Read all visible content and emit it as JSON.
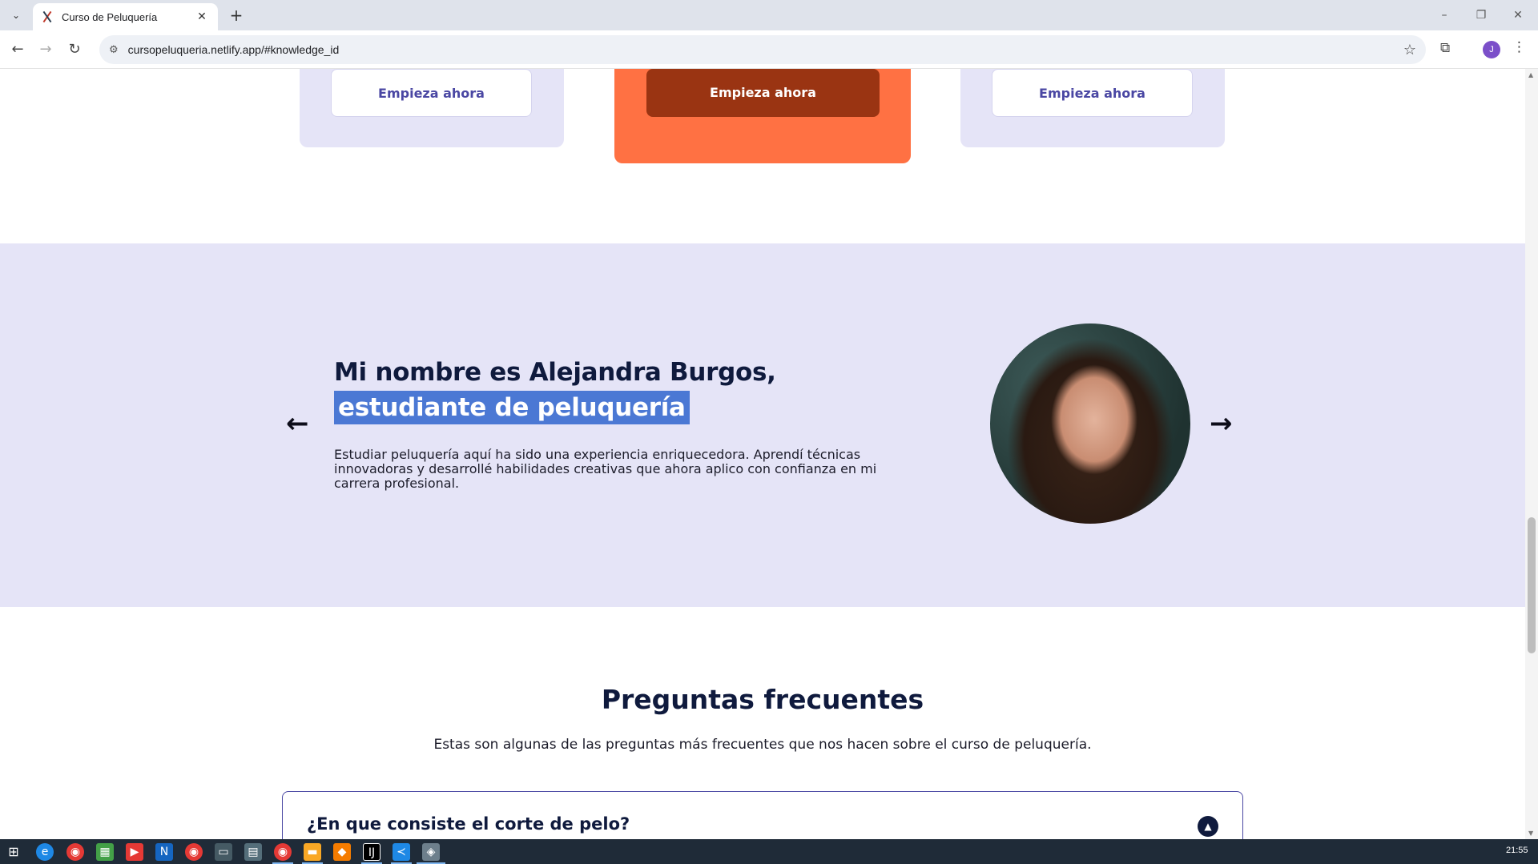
{
  "browser": {
    "tab_title": "Curso de Peluquería",
    "url": "cursopeluqueria.netlify.app/#knowledge_id",
    "profile_initial": "J"
  },
  "pricing": {
    "cta_labels": [
      "Empieza ahora",
      "Empieza ahora",
      "Empieza ahora"
    ]
  },
  "testimonial": {
    "heading_line1": "Mi nombre es Alejandra Burgos,",
    "heading_line2": "estudiante de peluquería",
    "body": "Estudiar peluquería aquí ha sido una experiencia enriquecedora. Aprendí técnicas innovadoras y desarrollé habilidades creativas que ahora aplico con confianza en mi carrera profesional."
  },
  "faq": {
    "title": "Preguntas frecuentes",
    "subtitle": "Estas son algunas de las preguntas más frecuentes que nos hacen sobre el curso de peluquería.",
    "questions": [
      "¿En que consiste el corte de pelo?"
    ]
  },
  "taskbar": {
    "clock": "21:55"
  },
  "colors": {
    "accent_orange": "#ff7143",
    "accent_dark_orange": "#9a3412",
    "lavender": "#e5e4f7",
    "navy": "#0f1a3d",
    "highlight": "#4b78d4"
  }
}
